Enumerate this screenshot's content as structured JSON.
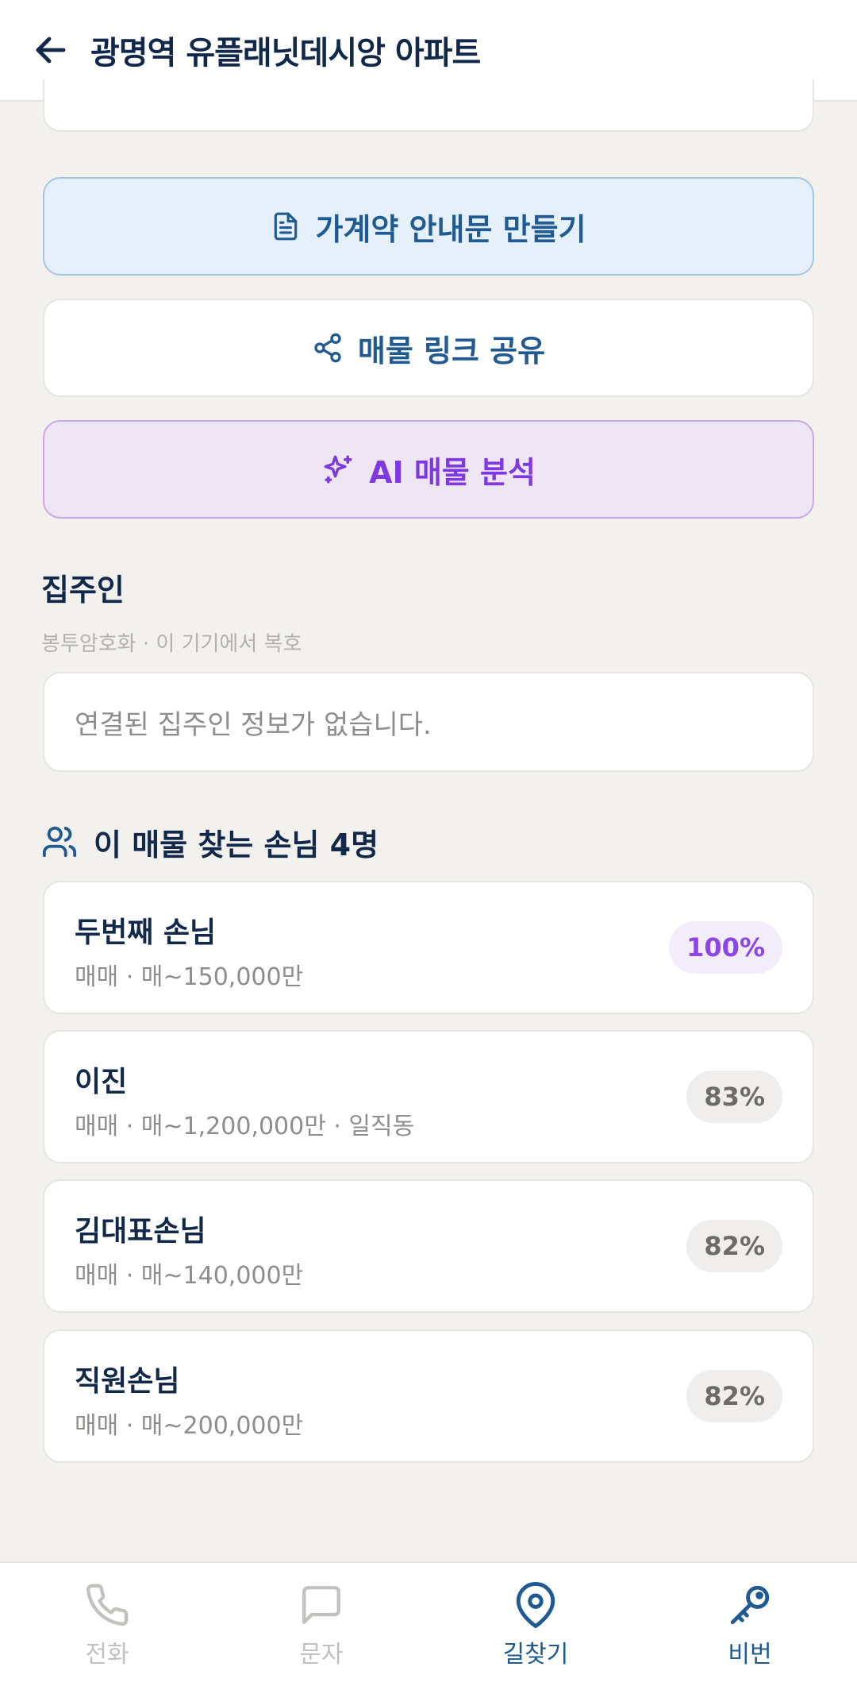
{
  "header": {
    "title": "광명역 유플래닛데시앙 아파트",
    "back_icon": "arrow-left-icon"
  },
  "actions": {
    "contract_label": "가계약 안내문 만들기",
    "share_label": "매물 링크 공유",
    "ai_label": "AI 매물 분석"
  },
  "landlord": {
    "title": "집주인",
    "subtitle": "봉투암호화 · 이 기기에서 복호",
    "empty_text": "연결된 집주인 정보가 없습니다."
  },
  "customers": {
    "header": "이 매물 찾는 손님 4명",
    "items": [
      {
        "name": "두번째 손님",
        "detail": "매매 · 매~150,000만",
        "match": "100%"
      },
      {
        "name": "이진",
        "detail": "매매 · 매~1,200,000만 · 일직동",
        "match": "83%"
      },
      {
        "name": "김대표손님",
        "detail": "매매 · 매~140,000만",
        "match": "82%"
      },
      {
        "name": "직원손님",
        "detail": "매매 · 매~200,000만",
        "match": "82%"
      }
    ]
  },
  "nav": {
    "items": [
      {
        "label": "전화",
        "icon": "phone-icon",
        "active": false
      },
      {
        "label": "문자",
        "icon": "message-icon",
        "active": false
      },
      {
        "label": "길찾기",
        "icon": "map-pin-icon",
        "active": true
      },
      {
        "label": "비번",
        "icon": "key-icon",
        "active": true
      }
    ]
  },
  "colors": {
    "accent_blue": "#1f5a93",
    "accent_purple": "#8c46e6",
    "background": "#f2f1ee"
  }
}
